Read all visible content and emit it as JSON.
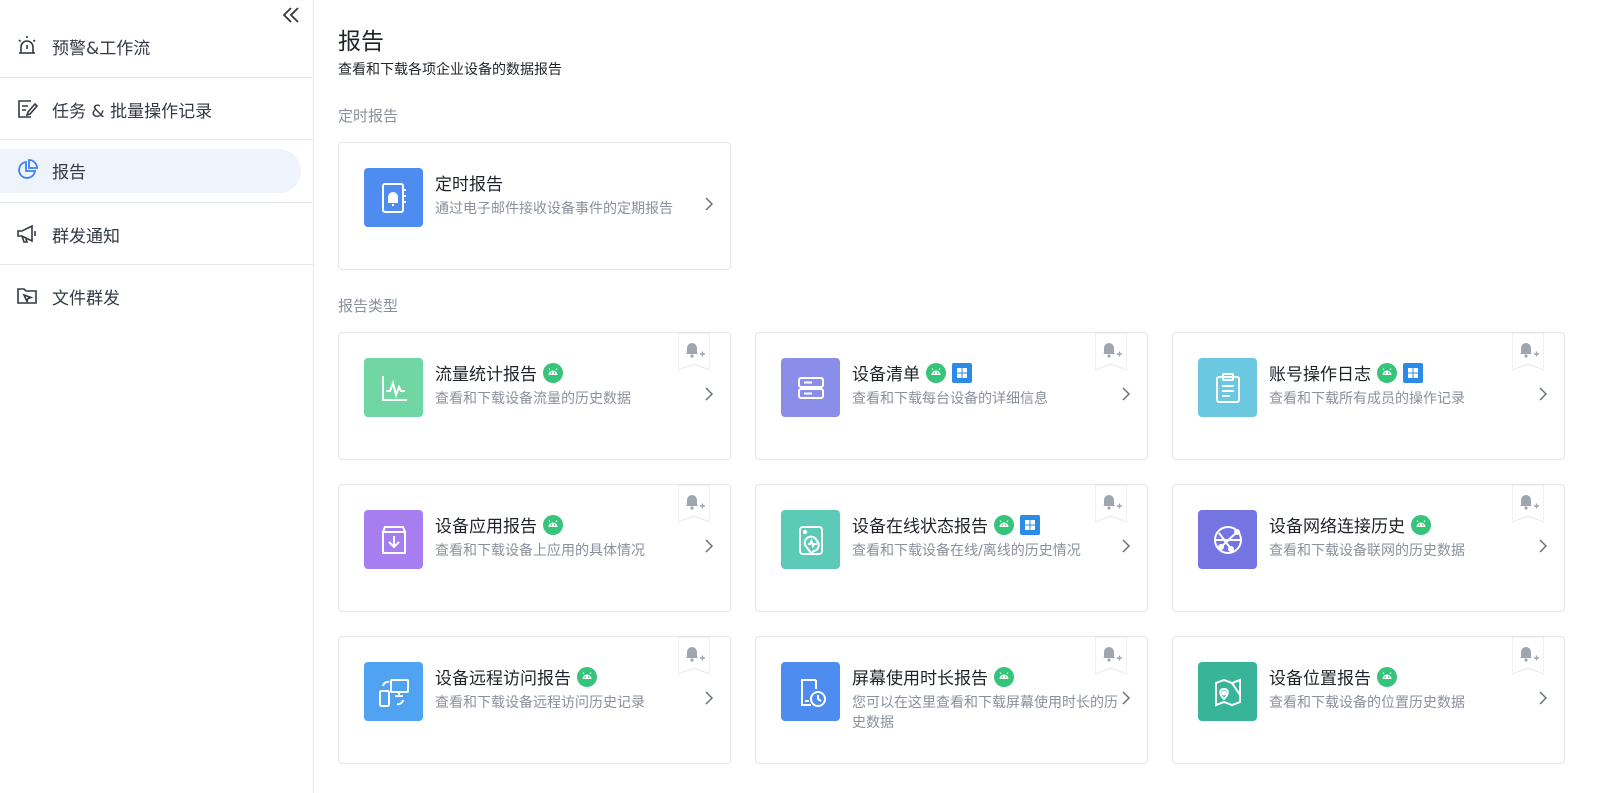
{
  "sidebar": {
    "items": [
      {
        "label": "预警&工作流",
        "icon": "alarm-icon"
      },
      {
        "label": "任务 & 批量操作记录",
        "icon": "task-edit-icon"
      },
      {
        "label": "报告",
        "icon": "pie-chart-icon",
        "active": true
      },
      {
        "label": "群发通知",
        "icon": "megaphone-icon"
      },
      {
        "label": "文件群发",
        "icon": "folder-send-icon"
      }
    ]
  },
  "main": {
    "title": "报告",
    "subtitle": "查看和下载各项企业设备的数据报告",
    "scheduled_section": "定时报告",
    "types_section": "报告类型"
  },
  "scheduled_card": {
    "title": "定时报告",
    "desc": "通过电子邮件接收设备事件的定期报告",
    "icon": "notebook-bell-icon",
    "color": "#4f8cf0"
  },
  "cards": [
    {
      "title": "流量统计报告",
      "desc": "查看和下载设备流量的历史数据",
      "icon": "traffic-chart-icon",
      "color": "#6fd6a4",
      "android": true,
      "windows": false
    },
    {
      "title": "设备清单",
      "desc": "查看和下载每台设备的详细信息",
      "icon": "server-list-icon",
      "color": "#8b8ee8",
      "android": true,
      "windows": true
    },
    {
      "title": "账号操作日志",
      "desc": "查看和下载所有成员的操作记录",
      "icon": "clipboard-icon",
      "color": "#6cc8e0",
      "android": true,
      "windows": true
    },
    {
      "title": "设备应用报告",
      "desc": "查看和下载设备上应用的具体情况",
      "icon": "app-download-icon",
      "color": "#a77ef0",
      "android": true,
      "windows": false
    },
    {
      "title": "设备在线状态报告",
      "desc": "查看和下载设备在线/离线的历史情况",
      "icon": "device-pulse-icon",
      "color": "#5ccab7",
      "android": true,
      "windows": true
    },
    {
      "title": "设备网络连接历史",
      "desc": "查看和下载设备联网的历史数据",
      "icon": "globe-network-icon",
      "color": "#7474e3",
      "android": true,
      "windows": false
    },
    {
      "title": "设备远程访问报告",
      "desc": "查看和下载设备远程访问历史记录",
      "icon": "remote-access-icon",
      "color": "#4fa3f0",
      "android": true,
      "windows": false
    },
    {
      "title": "屏幕使用时长报告",
      "desc": "您可以在这里查看和下载屏幕使用时长的历史数据",
      "icon": "screen-time-icon",
      "color": "#4f8cf0",
      "android": true,
      "windows": false
    },
    {
      "title": "设备位置报告",
      "desc": "查看和下载设备的位置历史数据",
      "icon": "location-map-icon",
      "color": "#38b598",
      "android": true,
      "windows": false
    }
  ]
}
